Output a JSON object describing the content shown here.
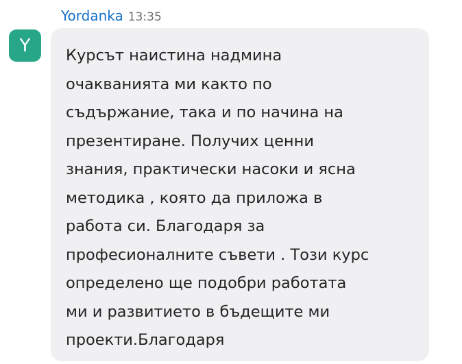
{
  "message": {
    "sender": "Yordanka",
    "time": "13:35",
    "avatar_initial": "Y",
    "text": "Курсът наистина надмина\nочакванията ми както по\nсъдържание, така и по начина на\nпрезентиране. Получих ценни\nзнания, практически насоки и ясна\nметодика , която да приложа в\nработа си. Благодаря за\nпрофесионалните съвети . Този курс\nопределено ще подобри работата\nми и развитието в бъдещите ми\nпроекти.Благодаря"
  },
  "colors": {
    "sender_name": "#1670c8",
    "avatar_background": "#27a688",
    "bubble_background": "#f0f0f2"
  }
}
